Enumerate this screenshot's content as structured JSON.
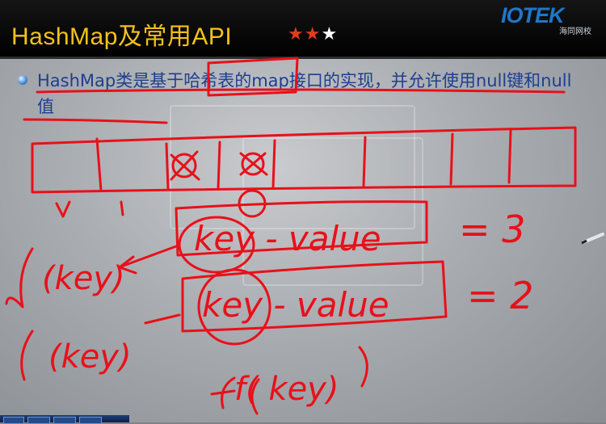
{
  "header": {
    "title": "HashMap及常用API",
    "stars_total": 3,
    "stars_filled": 2,
    "logo_text": "IOTEK",
    "logo_subtitle": "海同网校"
  },
  "content": {
    "bullet_text": "HashMap类是基于哈希表的map接口的实现，并允许使用null键和null值"
  },
  "annotations": {
    "key_left_1": "(key)",
    "key_left_2": "(key)",
    "entry_1": "key - value",
    "entry_2": "key - value",
    "count_1": "= 3",
    "count_2": "= 2",
    "key_bottom": "f( key)"
  },
  "colors": {
    "title": "#f3c21a",
    "star_filled": "#e23b1f",
    "ink": "#e8101a",
    "bullet_text": "#1e3f8f"
  }
}
